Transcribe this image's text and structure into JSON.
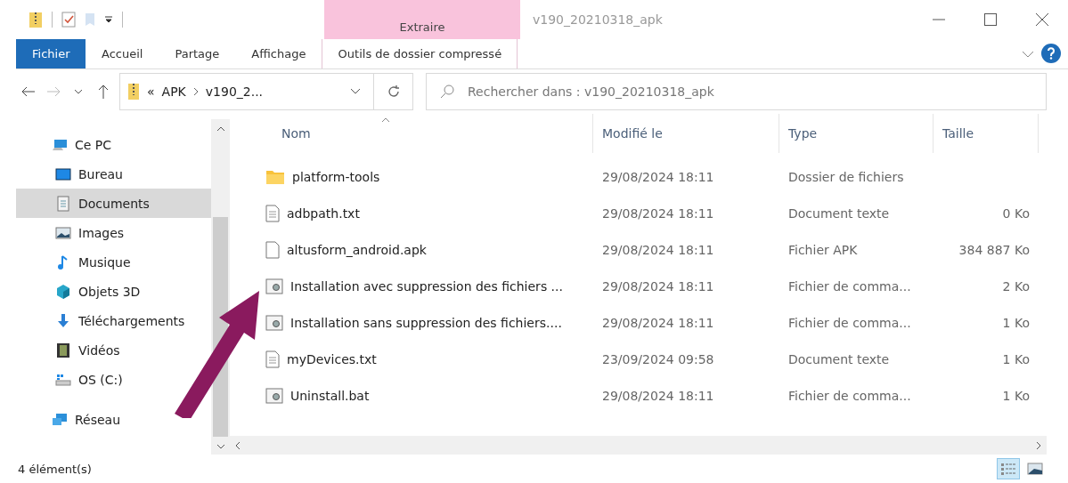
{
  "window": {
    "title": "v190_20210318_apk"
  },
  "context_tab": {
    "label": "Extraire"
  },
  "ribbon_tabs": [
    {
      "label": "Fichier",
      "kind": "file"
    },
    {
      "label": "Accueil",
      "kind": "tab"
    },
    {
      "label": "Partage",
      "kind": "tab"
    },
    {
      "label": "Affichage",
      "kind": "tab"
    },
    {
      "label": "Outils de dossier compressé",
      "kind": "context"
    }
  ],
  "address": {
    "overflow": "«",
    "crumbs": [
      "APK",
      "v190_2..."
    ]
  },
  "search": {
    "placeholder": "Rechercher dans : v190_20210318_apk"
  },
  "nav": [
    {
      "label": "Ce PC",
      "kind": "pc",
      "selected": false,
      "children": [
        {
          "label": "Bureau",
          "kind": "desktop",
          "selected": false
        },
        {
          "label": "Documents",
          "kind": "docs",
          "selected": true
        },
        {
          "label": "Images",
          "kind": "images",
          "selected": false
        },
        {
          "label": "Musique",
          "kind": "music",
          "selected": false
        },
        {
          "label": "Objets 3D",
          "kind": "cube",
          "selected": false
        },
        {
          "label": "Téléchargements",
          "kind": "download",
          "selected": false
        },
        {
          "label": "Vidéos",
          "kind": "video",
          "selected": false
        },
        {
          "label": "OS (C:)",
          "kind": "drive",
          "selected": false
        }
      ]
    },
    {
      "label": "Réseau",
      "kind": "network",
      "selected": false
    }
  ],
  "table": {
    "columns": [
      "Nom",
      "Modifié le",
      "Type",
      "Taille"
    ],
    "rows": [
      {
        "kind": "folder",
        "name": "platform-tools",
        "modified": "29/08/2024 18:11",
        "type": "Dossier de fichiers"
      },
      {
        "kind": "text",
        "name": "adbpath.txt",
        "modified": "29/08/2024 18:11",
        "type": "Document texte",
        "size": "0 Ko"
      },
      {
        "kind": "file",
        "name": "altusform_android.apk",
        "modified": "29/08/2024 18:11",
        "type": "Fichier APK",
        "size": "384 887 Ko"
      },
      {
        "kind": "script",
        "name": "Installation avec suppression des fichiers ...",
        "modified": "29/08/2024 18:11",
        "type": "Fichier de comma...",
        "size": "2 Ko"
      },
      {
        "kind": "script",
        "name": "Installation sans suppression des fichiers....",
        "modified": "29/08/2024 18:11",
        "type": "Fichier de comma...",
        "size": "1 Ko"
      },
      {
        "kind": "text",
        "name": "myDevices.txt",
        "modified": "23/09/2024 09:58",
        "type": "Document texte",
        "size": "1 Ko"
      },
      {
        "kind": "script",
        "name": "Uninstall.bat",
        "modified": "29/08/2024 18:11",
        "type": "Fichier de comma...",
        "size": "1 Ko"
      }
    ]
  },
  "status_bar": {
    "count": "4 élément(s)",
    "views": [
      {
        "kind": "details",
        "selected": true
      },
      {
        "kind": "tiles",
        "selected": false
      }
    ]
  }
}
